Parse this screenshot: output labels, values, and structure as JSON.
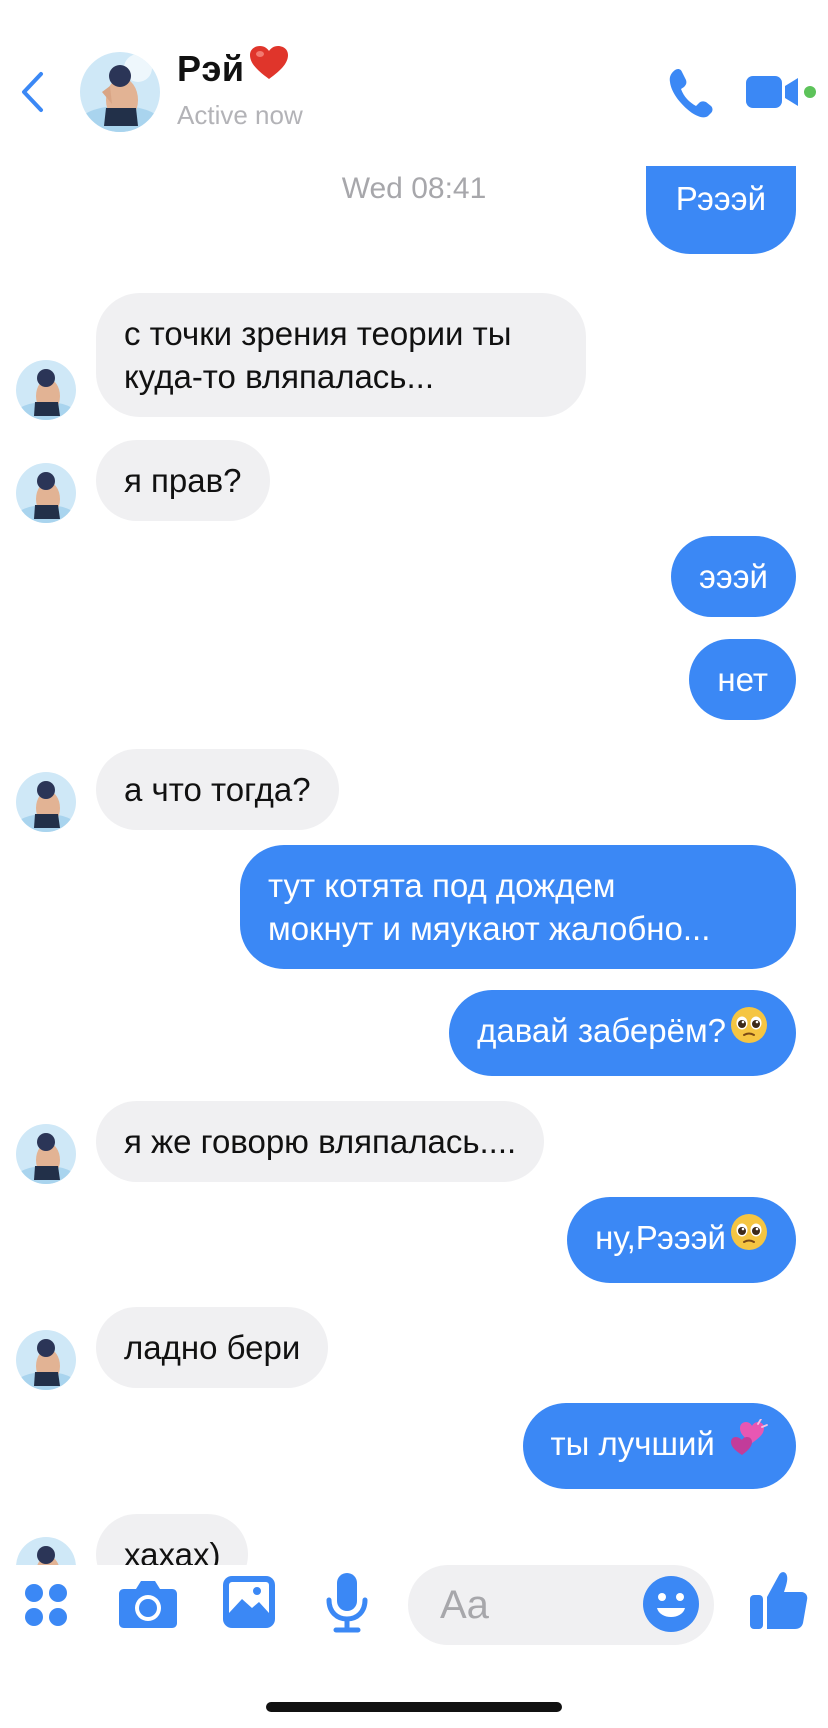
{
  "header": {
    "contact_name": "Рэй",
    "contact_status": "Active now"
  },
  "timestamp": "Wed 08:41",
  "messages": [
    {
      "dir": "out",
      "text": "Рэээй"
    },
    {
      "dir": "in",
      "lines": [
        "с точки зрения теории ты",
        "куда-то вляпалась..."
      ]
    },
    {
      "dir": "in",
      "text": "я прав?"
    },
    {
      "dir": "out",
      "text": "эээй"
    },
    {
      "dir": "out",
      "text": "нет"
    },
    {
      "dir": "in",
      "text": "а что тогда?"
    },
    {
      "dir": "out",
      "lines": [
        "тут котята под дождем",
        "мокнут и мяукают жалобно..."
      ]
    },
    {
      "dir": "out",
      "text": "давай заберём?",
      "emoji": "pleading-face-icon"
    },
    {
      "dir": "in",
      "text": "я же говорю вляпалась...."
    },
    {
      "dir": "out",
      "text": "ну,Рэээй",
      "emoji": "pleading-face-icon"
    },
    {
      "dir": "in",
      "text": "ладно бери"
    },
    {
      "dir": "out",
      "text": "ты лучший ",
      "emoji": "two-hearts-icon"
    },
    {
      "dir": "in",
      "text": "хахах)"
    }
  ],
  "composer": {
    "placeholder": "Aa"
  },
  "icons": {
    "back": "chevron-left-icon",
    "call": "phone-icon",
    "video": "video-camera-icon",
    "menu": "four-dots-icon",
    "camera": "camera-icon",
    "gallery": "image-icon",
    "mic": "microphone-icon",
    "emoji": "smiley-icon",
    "like": "thumbs-up-icon"
  },
  "colors": {
    "accent": "#3b88f5",
    "incoming_bubble": "#f0f0f2",
    "active_dot": "#5dc35a",
    "heart": "#e0352b"
  }
}
